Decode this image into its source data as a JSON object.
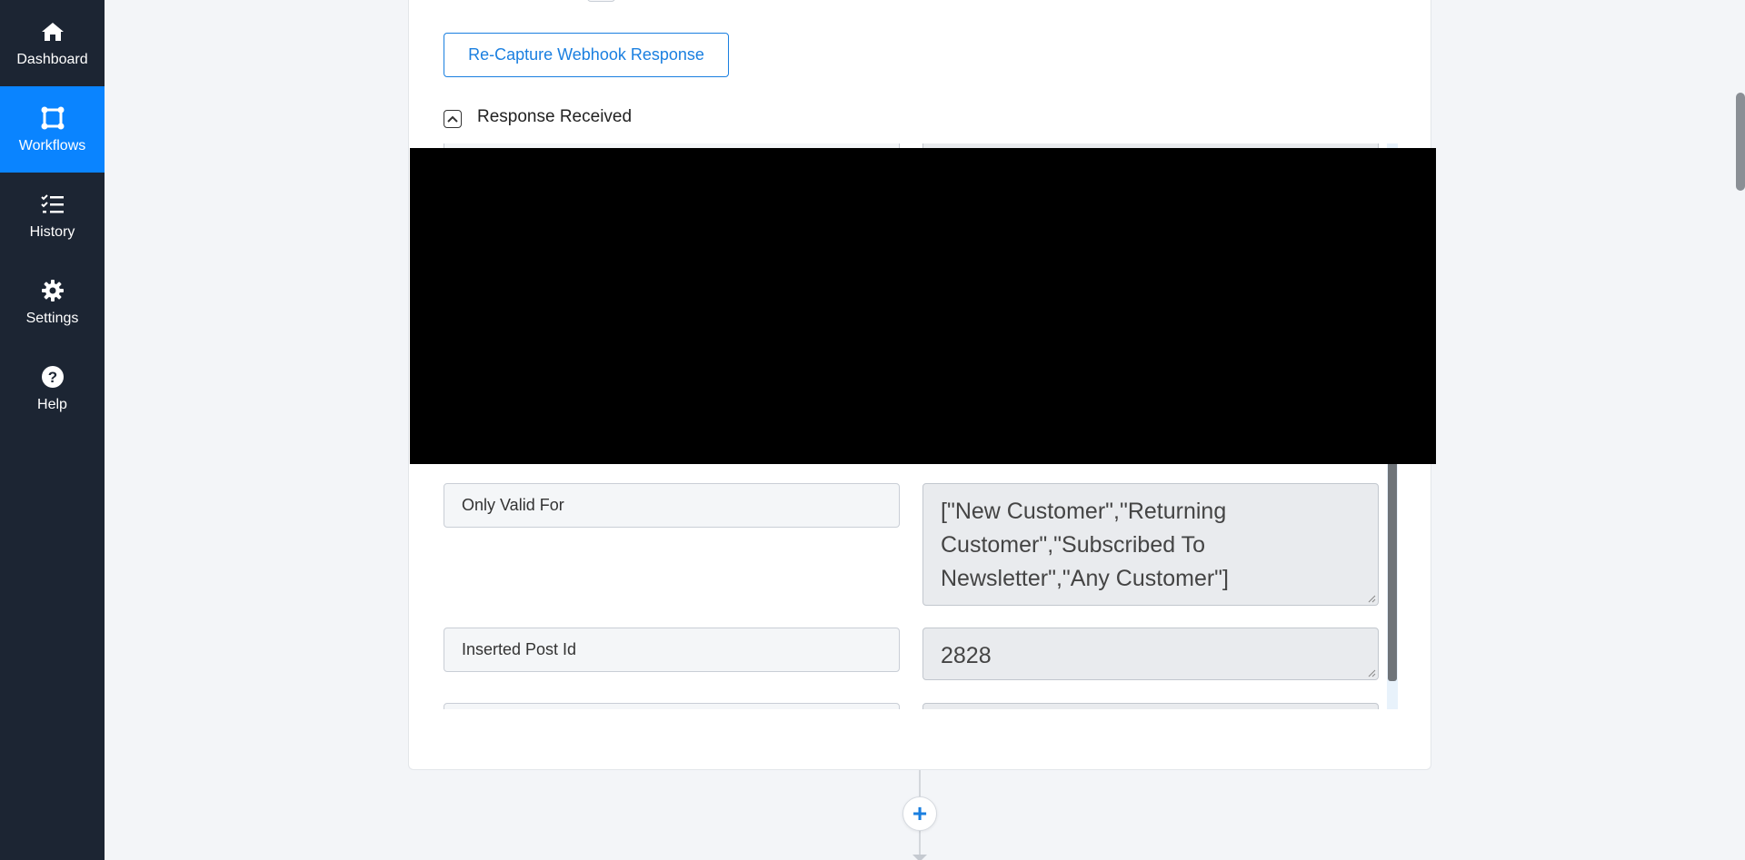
{
  "sidebar": {
    "items": [
      {
        "label": "Dashboard",
        "icon": "home-icon",
        "active": false
      },
      {
        "label": "Workflows",
        "icon": "workflow-icon",
        "active": true
      },
      {
        "label": "History",
        "icon": "history-checklist-icon",
        "active": false
      },
      {
        "label": "Settings",
        "icon": "gear-icon",
        "active": false
      },
      {
        "label": "Help",
        "icon": "help-icon",
        "active": false
      }
    ]
  },
  "step": {
    "recapture_label": "Re-Capture Webhook Response",
    "response_title": "Response Received",
    "fields": [
      {
        "key": "Only Valid For",
        "value": "[\"New Customer\",\"Returning Customer\",\"Subscribed To Newsletter\",\"Any Customer\"]"
      },
      {
        "key": "Inserted Post Id",
        "value": "2828"
      }
    ]
  },
  "add_step_symbol": "+",
  "colors": {
    "sidebar_bg": "#1c2533",
    "accent": "#0a84ff",
    "page_bg": "#f3f5f8"
  }
}
